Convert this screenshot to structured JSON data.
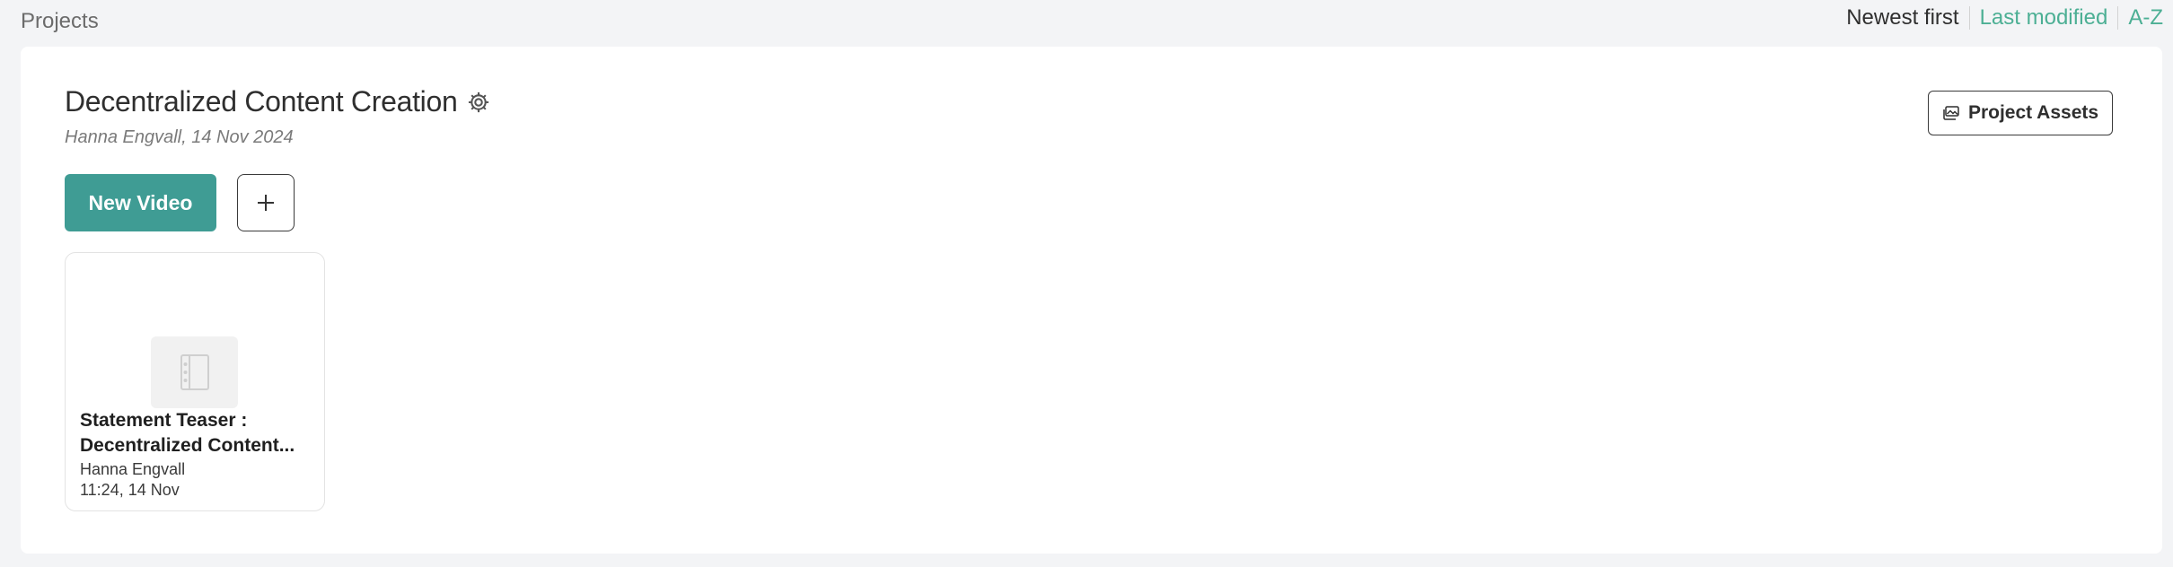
{
  "header": {
    "breadcrumb": "Projects",
    "sort_options": [
      {
        "label": "Newest first",
        "active": true
      },
      {
        "label": "Last modified",
        "active": false
      },
      {
        "label": "A-Z",
        "active": false
      }
    ]
  },
  "project": {
    "title": "Decentralized Content Creation",
    "meta": "Hanna Engvall, 14 Nov 2024",
    "assets_button": "Project Assets",
    "new_video_button": "New Video",
    "add_icon": "plus-icon",
    "settings_icon": "gear-icon"
  },
  "videos": [
    {
      "title_line1": "Statement Teaser :",
      "title_line2": "Decentralized Content...",
      "author": "Hanna Engvall",
      "time": "11:24, 14 Nov",
      "thumbnail_icon": "document-placeholder-icon"
    }
  ],
  "colors": {
    "accent": "#3f9c94",
    "link": "#4caf94",
    "background": "#f3f4f6"
  }
}
